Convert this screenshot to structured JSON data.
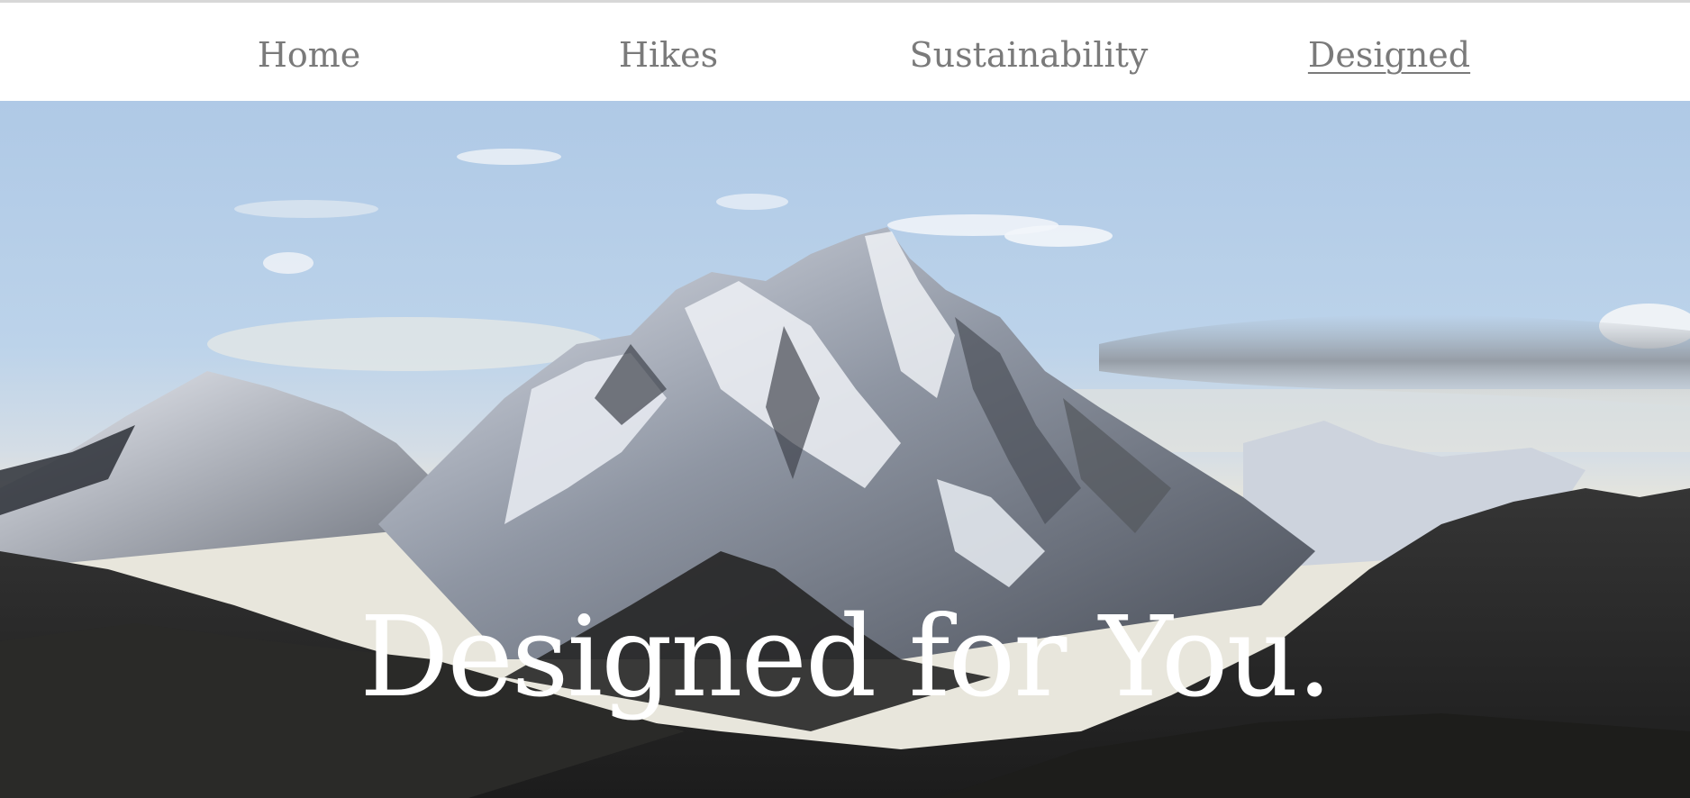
{
  "nav": {
    "items": [
      {
        "label": "Home"
      },
      {
        "label": "Hikes"
      },
      {
        "label": "Sustainability"
      },
      {
        "label": "Designed"
      }
    ],
    "active_label": "Designed"
  },
  "hero": {
    "headline": "Designed for You.",
    "image_subject": "snow-capped mountain range under blue sky",
    "colors": {
      "sky": "#b5cde8",
      "snow": "#e4e8ef",
      "rock": "#3b3f47",
      "foreground": "#232323"
    }
  },
  "colors": {
    "nav_text": "#7a7a7a",
    "nav_background": "#ffffff",
    "headline_text": "#ffffff"
  }
}
